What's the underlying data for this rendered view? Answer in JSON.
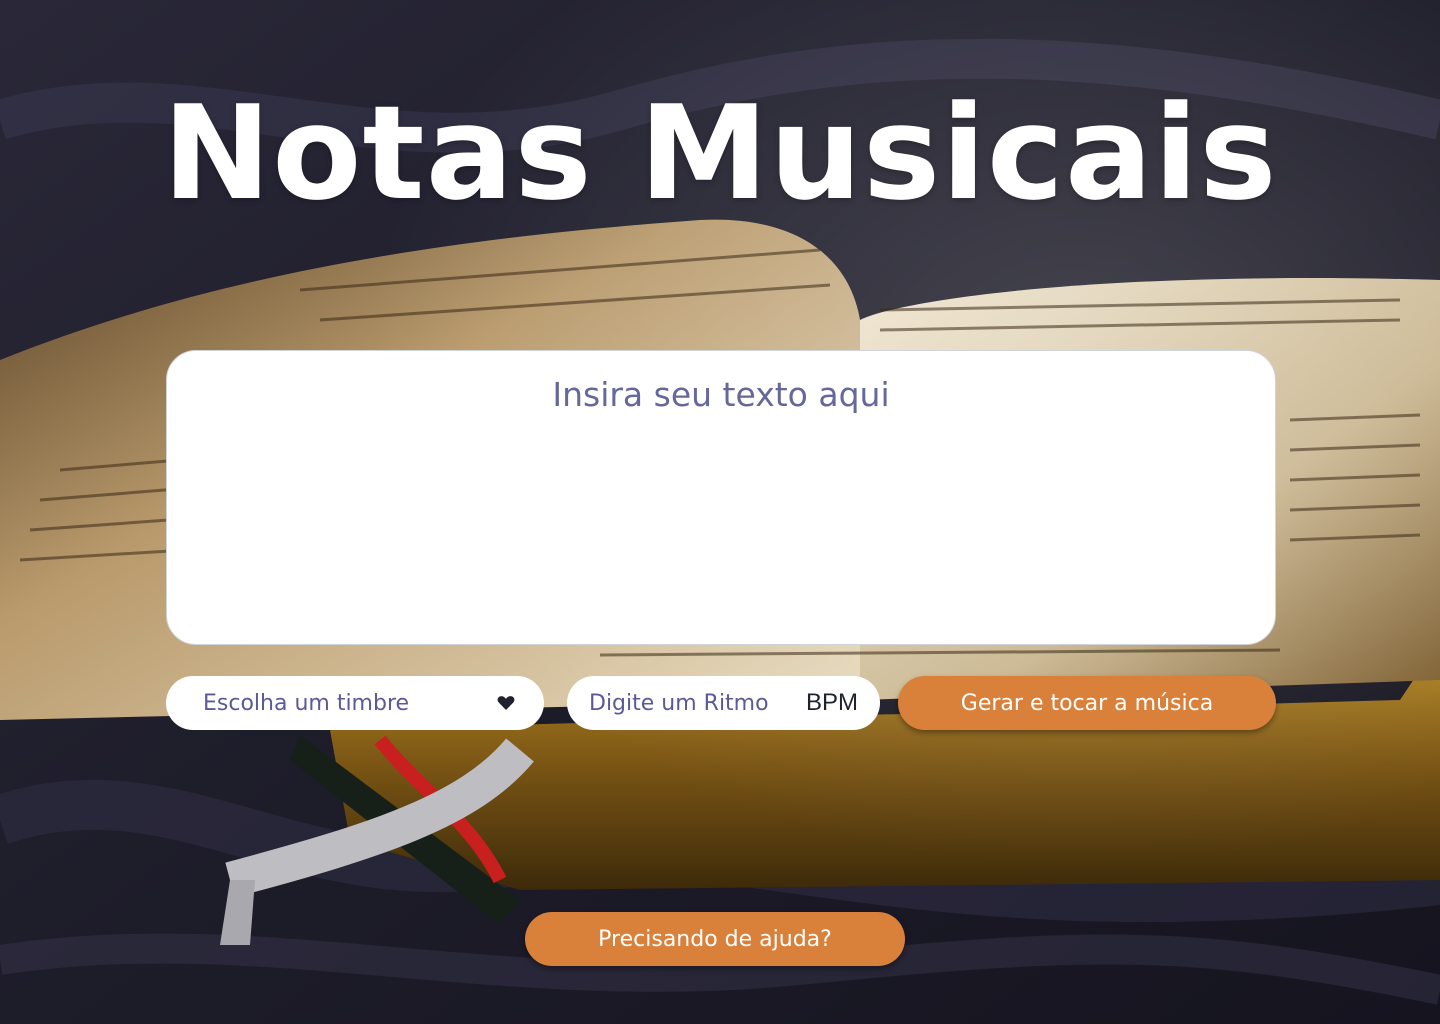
{
  "page": {
    "title": "Notas Musicais"
  },
  "editor": {
    "placeholder": "Insira seu texto aqui",
    "value": ""
  },
  "controls": {
    "timbre_select_label": "Escolha um timbre",
    "timbre_icon": "heart-icon",
    "rhythm_placeholder": "Digite um Ritmo",
    "rhythm_value": "",
    "rhythm_unit": "BPM",
    "generate_button_label": "Gerar e tocar a música"
  },
  "help": {
    "button_label": "Precisando de ajuda?"
  },
  "colors": {
    "accent": "#d9803a",
    "placeholder_text": "#5b5a97",
    "title_text": "#ffffff"
  }
}
